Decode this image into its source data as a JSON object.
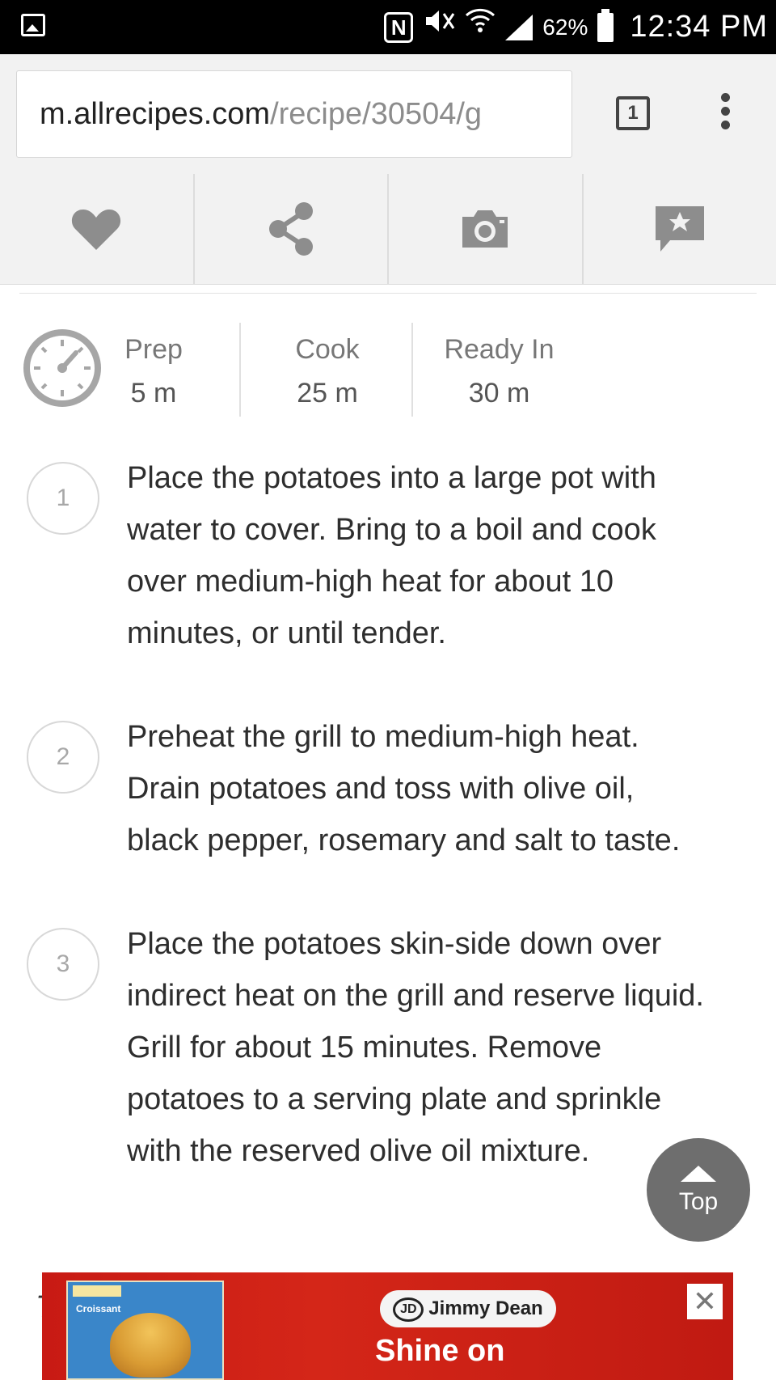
{
  "status_bar": {
    "battery": "62%",
    "time": "12:34 PM",
    "nfc": "N"
  },
  "browser": {
    "url_domain": "m.allrecipes.com",
    "url_path": "/recipe/30504/g",
    "tab_count": "1"
  },
  "actions": [
    "heart-icon",
    "share-icon",
    "camera-icon",
    "review-icon"
  ],
  "times": {
    "prep_label": "Prep",
    "prep_value": "5 m",
    "cook_label": "Cook",
    "cook_value": "25 m",
    "ready_label": "Ready In",
    "ready_value": "30 m"
  },
  "steps": [
    {
      "number": "1",
      "lines": [
        "Place the potatoes into a large pot with",
        "water to cover. Bring to a boil and cook",
        "over medium-high heat for about 10",
        "minutes, or until tender."
      ]
    },
    {
      "number": "2",
      "lines": [
        "Preheat the grill to medium-high heat.",
        "Drain potatoes and toss with olive oil,",
        "black pepper, rosemary and salt to taste."
      ]
    },
    {
      "number": "3",
      "lines": [
        "Place the potatoes skin-side down over",
        "indirect heat on the grill and reserve liquid.",
        "Grill for about 15 minutes. Remove",
        "potatoes to a serving plate and sprinkle",
        "with the reserved olive oil mixture."
      ]
    }
  ],
  "top_button": "Top",
  "cut_text": "T",
  "ad": {
    "brand": "Jimmy Dean",
    "logo_mark": "JD",
    "tagline": "Shine on",
    "product_label": "Croissant",
    "close": "✕"
  }
}
